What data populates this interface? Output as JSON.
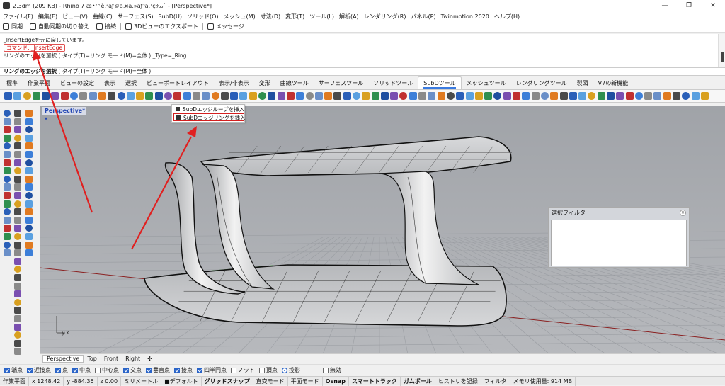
{
  "window": {
    "title": "2.3dm (209 KB) - Rhino 7 æ•™è‚²ãƒ©ã‚¤ã‚»ãƒ³ã‚¹ç‰ˆ - [Perspective*]",
    "controls": [
      "—",
      "❐",
      "✕"
    ]
  },
  "menu": [
    "ファイル(F)",
    "編集(E)",
    "ビュー(V)",
    "曲線(C)",
    "サーフェス(S)",
    "SubD(U)",
    "ソリッド(O)",
    "メッシュ(M)",
    "寸法(D)",
    "変形(T)",
    "ツール(L)",
    "解析(A)",
    "レンダリング(R)",
    "パネル(P)",
    "Twinmotion 2020",
    "ヘルプ(H)"
  ],
  "command_toolbar": {
    "sync": "同期",
    "auto_sync": "自動同期の切り替え",
    "connect": "接続",
    "export_3d": "3Dビューのエクスポート",
    "message": "メッセージ"
  },
  "history": {
    "line1": "_InsertEdgeを元に戻しています。",
    "line2_prefix": "コマンド: ",
    "line2_cmd": "_InsertEdge",
    "line3": "リングのエッジを選択 ( タイプ(T)=リング  モード(M)=全体 ) _Type=_Ring"
  },
  "prompt": {
    "bold": "リングのエッジを選択",
    "rest": " ( タイプ(T)=リング  モード(M)=全体 )"
  },
  "tabs": [
    "標準",
    "作業平面",
    "ビューの設定",
    "表示",
    "選択",
    "ビューポートレイアウト",
    "表示/非表示",
    "変形",
    "曲線ツール",
    "サーフェスツール",
    "ソリッドツール",
    "SubDツール",
    "メッシュツール",
    "レンダリングツール",
    "製図",
    "V7の新機能"
  ],
  "active_tab": "SubDツール",
  "viewport": {
    "label": "Perspective*",
    "axis_x": "x",
    "axis_y": "y"
  },
  "popup": {
    "item1": "SubDエッジループを挿入",
    "item2": "SubDエッジリングを挿入"
  },
  "filter_panel": {
    "title": "選択フィルタ"
  },
  "viewport_tabs": [
    "Perspective",
    "Top",
    "Front",
    "Right"
  ],
  "viewport_tab_add": "✣",
  "osnaps": [
    {
      "label": "端点",
      "on": true
    },
    {
      "label": "近接点",
      "on": true
    },
    {
      "label": "点",
      "on": true
    },
    {
      "label": "中点",
      "on": true
    },
    {
      "label": "中心点",
      "on": false
    },
    {
      "label": "交点",
      "on": true
    },
    {
      "label": "垂直点",
      "on": true
    },
    {
      "label": "接点",
      "on": true
    },
    {
      "label": "四半円点",
      "on": true
    },
    {
      "label": "ノット",
      "on": false
    },
    {
      "label": "頂点",
      "on": false
    },
    {
      "label": "投影",
      "on": true,
      "radio": true
    },
    {
      "label": "無効",
      "on": false
    }
  ],
  "status": {
    "cplane": "作業平面",
    "x": "x 1248.42",
    "y": "y -884.36",
    "z": "z 0.00",
    "unit": "ミリメートル",
    "layer": "■デフォルト",
    "grid_snap": "グリッドスナップ",
    "ortho": "直交モード",
    "planar": "平面モード",
    "osnap": "Osnap",
    "smarttrack": "スマートトラック",
    "gumball": "ガムボール",
    "history": "ヒストリを記録",
    "filter": "フィルタ",
    "memory": "メモリ使用量: 914 MB"
  },
  "colors": {
    "annotation_red": "#e02020",
    "viewport_bg": "#a9acb1",
    "accent_blue": "#3a7be0"
  }
}
